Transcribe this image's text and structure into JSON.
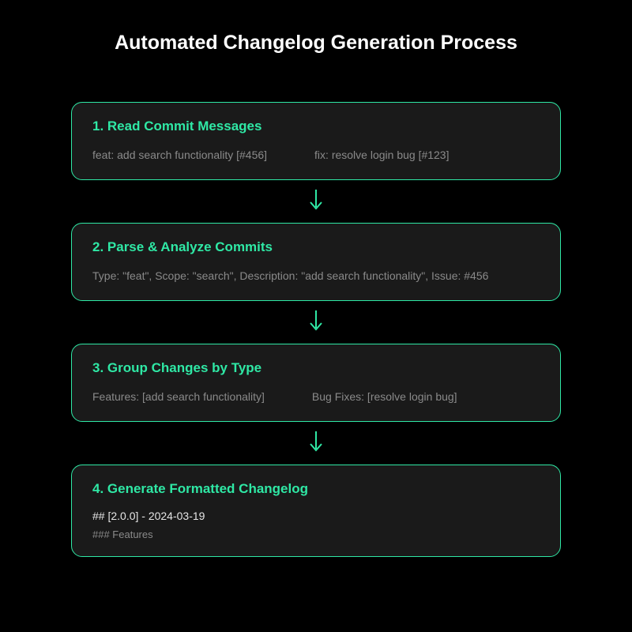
{
  "title": "Automated Changelog Generation Process",
  "steps": [
    {
      "heading": "1. Read Commit Messages",
      "body_left": "feat: add search functionality [#456]",
      "body_right": "fix: resolve login bug [#123]"
    },
    {
      "heading": "2. Parse & Analyze Commits",
      "body_single": "Type: \"feat\", Scope: \"search\", Description: \"add search functionality\", Issue: #456"
    },
    {
      "heading": "3. Group Changes by Type",
      "body_left": "Features: [add search functionality]",
      "body_right": "Bug Fixes: [resolve login bug]"
    },
    {
      "heading": "4. Generate Formatted Changelog",
      "code_line": "## [2.0.0] - 2024-03-19",
      "sub_line": "### Features"
    }
  ],
  "colors": {
    "accent": "#2fe8a5",
    "background": "#000000",
    "card": "#1a1a1a",
    "muted": "#8a8a8a"
  }
}
